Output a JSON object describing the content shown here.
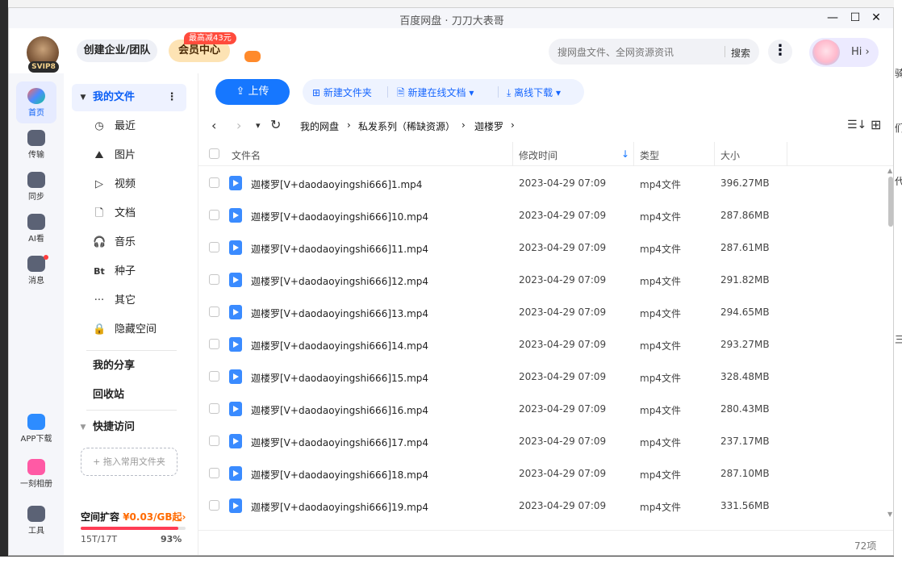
{
  "window": {
    "title": "百度网盘 · 刀刀大表哥",
    "minimize": "—",
    "maximize": "☐",
    "close": "✕"
  },
  "header": {
    "svip_badge": "SVIP8",
    "create_team": "创建企业/团队",
    "vip_center": "会员中心",
    "vip_promo": "最高减43元",
    "search_placeholder": "搜网盘文件、全网资源资讯",
    "search_button": "搜索",
    "more": "⋮",
    "hi_label": "Hi ›"
  },
  "rail": [
    {
      "label": "首页",
      "icon": "home-icon",
      "active": true
    },
    {
      "label": "传输",
      "icon": "transfer-icon"
    },
    {
      "label": "同步",
      "icon": "sync-icon"
    },
    {
      "label": "AI看",
      "icon": "ai-watch-icon"
    },
    {
      "label": "消息",
      "icon": "message-icon"
    },
    {
      "label": "APP下载",
      "icon": "app-download-icon"
    },
    {
      "label": "一刻相册",
      "icon": "album-icon"
    },
    {
      "label": "工具",
      "icon": "tools-icon"
    }
  ],
  "nav": {
    "my_files": "我的文件",
    "my_files_more": "⋮",
    "items": [
      {
        "label": "最近",
        "glyph": "◷"
      },
      {
        "label": "图片",
        "glyph": "⛰"
      },
      {
        "label": "视频",
        "glyph": "▷"
      },
      {
        "label": "文档",
        "glyph": "🗋"
      },
      {
        "label": "音乐",
        "glyph": "🎧"
      },
      {
        "label": "种子",
        "glyph": "Bt"
      },
      {
        "label": "其它",
        "glyph": "···"
      },
      {
        "label": "隐藏空间",
        "glyph": "🔒"
      }
    ],
    "my_share": "我的分享",
    "recycle": "回收站",
    "quick_access": "快捷访问",
    "drop_hint": "+ 拖入常用文件夹",
    "space_title": "空间扩容",
    "space_price": "¥0.03/GB起",
    "space_arrow": "›",
    "space_used": "15T/17T",
    "space_percent": "93%",
    "space_fraction": 0.93
  },
  "toolbar": {
    "upload": "上传",
    "new_folder": "新建文件夹",
    "new_doc": "新建在线文档",
    "offline": "离线下载"
  },
  "breadcrumb": {
    "back": "‹",
    "forward": "›",
    "drop": "▾",
    "refresh": "↻",
    "path": [
      {
        "label": "我的网盘"
      },
      {
        "sep": "›",
        "label": "私发系列（稀缺资源）"
      },
      {
        "sep": "›",
        "label": "迦楼罗"
      },
      {
        "sep": "›",
        "label": ""
      }
    ],
    "sort_icon": "☰↓",
    "grid_icon": "⊞"
  },
  "columns": {
    "name": "文件名",
    "mtime": "修改时间",
    "sort": "↓",
    "type": "类型",
    "size": "大小"
  },
  "files": [
    {
      "name": "迦楼罗[V+daodaoyingshi666]1.mp4",
      "mtime": "2023-04-29 07:09",
      "type": "mp4文件",
      "size": "396.27MB"
    },
    {
      "name": "迦楼罗[V+daodaoyingshi666]10.mp4",
      "mtime": "2023-04-29 07:09",
      "type": "mp4文件",
      "size": "287.86MB"
    },
    {
      "name": "迦楼罗[V+daodaoyingshi666]11.mp4",
      "mtime": "2023-04-29 07:09",
      "type": "mp4文件",
      "size": "287.61MB"
    },
    {
      "name": "迦楼罗[V+daodaoyingshi666]12.mp4",
      "mtime": "2023-04-29 07:09",
      "type": "mp4文件",
      "size": "291.82MB"
    },
    {
      "name": "迦楼罗[V+daodaoyingshi666]13.mp4",
      "mtime": "2023-04-29 07:09",
      "type": "mp4文件",
      "size": "294.65MB"
    },
    {
      "name": "迦楼罗[V+daodaoyingshi666]14.mp4",
      "mtime": "2023-04-29 07:09",
      "type": "mp4文件",
      "size": "293.27MB"
    },
    {
      "name": "迦楼罗[V+daodaoyingshi666]15.mp4",
      "mtime": "2023-04-29 07:09",
      "type": "mp4文件",
      "size": "328.48MB"
    },
    {
      "name": "迦楼罗[V+daodaoyingshi666]16.mp4",
      "mtime": "2023-04-29 07:09",
      "type": "mp4文件",
      "size": "280.43MB"
    },
    {
      "name": "迦楼罗[V+daodaoyingshi666]17.mp4",
      "mtime": "2023-04-29 07:09",
      "type": "mp4文件",
      "size": "237.17MB"
    },
    {
      "name": "迦楼罗[V+daodaoyingshi666]18.mp4",
      "mtime": "2023-04-29 07:09",
      "type": "mp4文件",
      "size": "287.10MB"
    },
    {
      "name": "迦楼罗[V+daodaoyingshi666]19.mp4",
      "mtime": "2023-04-29 07:09",
      "type": "mp4文件",
      "size": "331.56MB"
    }
  ],
  "footer": {
    "count": "72项"
  },
  "desktop_edge": [
    "骑",
    "们",
    "代",
    "三"
  ]
}
